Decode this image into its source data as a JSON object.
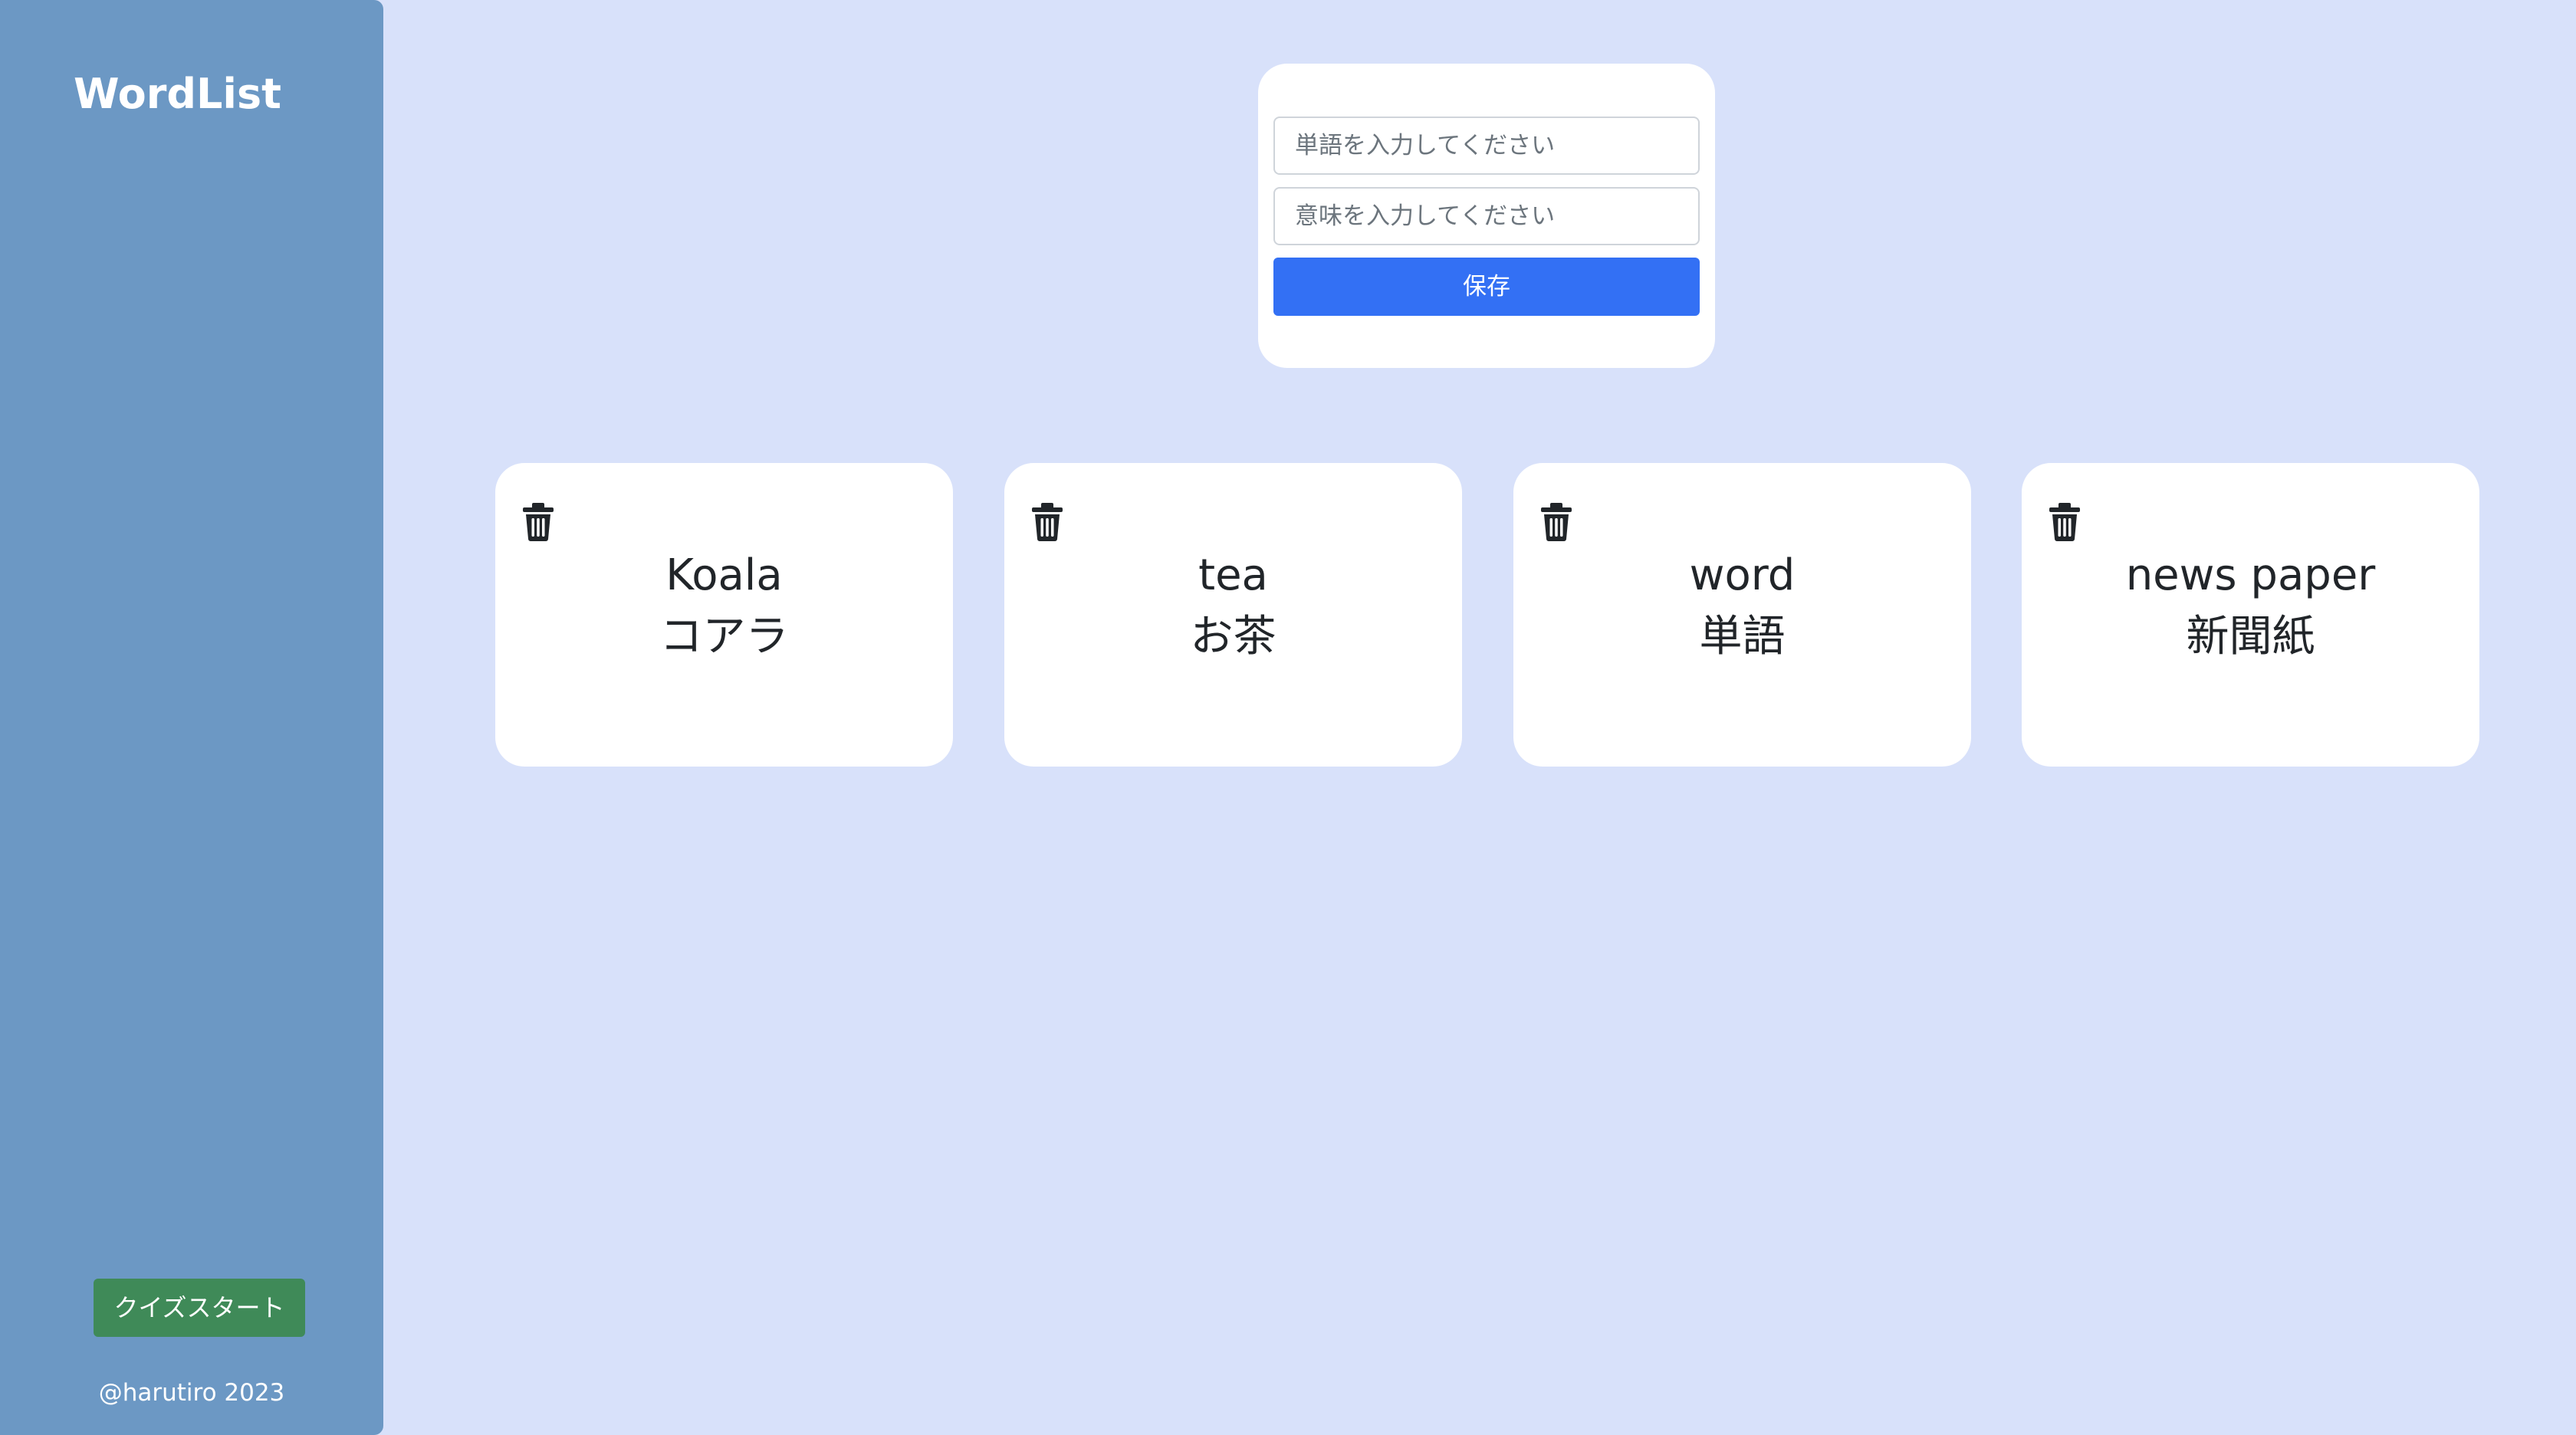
{
  "sidebar": {
    "brand": "WordList",
    "quiz_button": "クイズスタート",
    "copyright": "@harutiro 2023"
  },
  "form": {
    "word_placeholder": "単語を入力してください",
    "meaning_placeholder": "意味を入力してください",
    "save_label": "保存"
  },
  "cards": [
    {
      "word": "Koala",
      "meaning": "コアラ"
    },
    {
      "word": "tea",
      "meaning": "お茶"
    },
    {
      "word": "word",
      "meaning": "単語"
    },
    {
      "word": "news paper",
      "meaning": "新聞紙"
    }
  ],
  "colors": {
    "background": "#d8e1fa",
    "sidebar": "#6c98c4",
    "primary": "#3370f4",
    "success": "#3f8a58"
  },
  "icons": {
    "delete": "trash-icon"
  }
}
